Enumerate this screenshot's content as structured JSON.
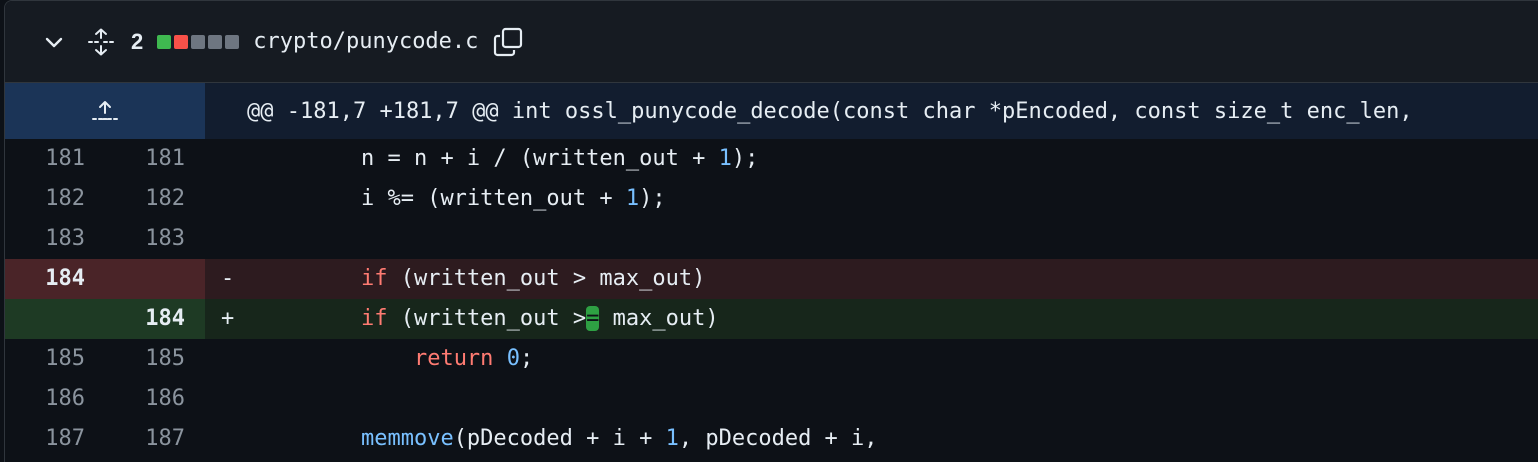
{
  "file": {
    "changes_count": "2",
    "path": "crypto/punycode.c",
    "diffstat": [
      "#3fb950",
      "#f85149",
      "#6e7681",
      "#6e7681",
      "#6e7681"
    ]
  },
  "hunk": {
    "header": "@@ -181,7 +181,7 @@ int ossl_punycode_decode(const char *pEncoded, const size_t enc_len,"
  },
  "lines": [
    {
      "old": "181",
      "new": "181",
      "type": "ctx",
      "indent": "        ",
      "segments": [
        {
          "t": "n = n + i / (written_out + "
        },
        {
          "t": "1",
          "c": "lit"
        },
        {
          "t": ");"
        }
      ]
    },
    {
      "old": "182",
      "new": "182",
      "type": "ctx",
      "indent": "        ",
      "segments": [
        {
          "t": "i %= (written_out + "
        },
        {
          "t": "1",
          "c": "lit"
        },
        {
          "t": ");"
        }
      ]
    },
    {
      "old": "183",
      "new": "183",
      "type": "ctx",
      "indent": "",
      "segments": []
    },
    {
      "old": "184",
      "new": "",
      "type": "del",
      "sign": "-",
      "indent": "        ",
      "segments": [
        {
          "t": "if",
          "c": "kw"
        },
        {
          "t": " (written_out > max_out)"
        }
      ]
    },
    {
      "old": "",
      "new": "184",
      "type": "add",
      "sign": "+",
      "indent": "        ",
      "segments": [
        {
          "t": "if",
          "c": "kw"
        },
        {
          "t": " (written_out >"
        },
        {
          "t": "=",
          "c": "hl"
        },
        {
          "t": " max_out)"
        }
      ]
    },
    {
      "old": "185",
      "new": "185",
      "type": "ctx",
      "indent": "            ",
      "segments": [
        {
          "t": "return",
          "c": "kw"
        },
        {
          "t": " "
        },
        {
          "t": "0",
          "c": "lit"
        },
        {
          "t": ";"
        }
      ]
    },
    {
      "old": "186",
      "new": "186",
      "type": "ctx",
      "indent": "",
      "segments": []
    },
    {
      "old": "187",
      "new": "187",
      "type": "ctx",
      "indent": "        ",
      "segments": [
        {
          "t": "memmove",
          "c": "fnb"
        },
        {
          "t": "(pDecoded + i + "
        },
        {
          "t": "1",
          "c": "lit"
        },
        {
          "t": ", pDecoded + i,"
        }
      ]
    }
  ],
  "icons": {
    "collapse": "chevron-down-icon",
    "expand": "unfold-icon",
    "copy": "copy-icon",
    "expand_up": "expand-up-icon"
  }
}
